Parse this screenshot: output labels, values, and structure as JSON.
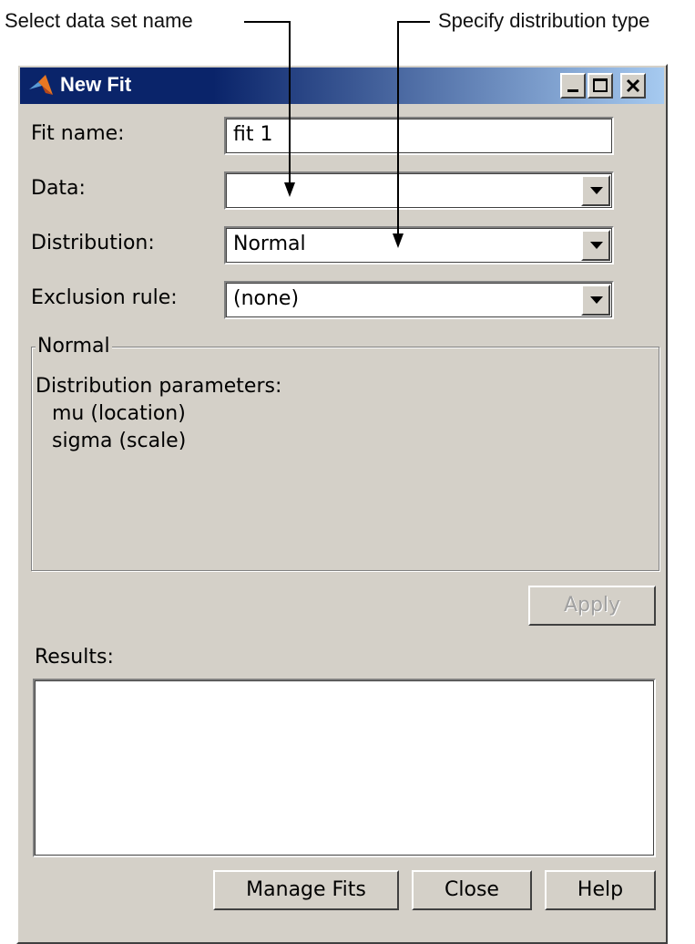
{
  "callouts": {
    "left": "Select data set name",
    "right": "Specify distribution type"
  },
  "window": {
    "title": "New Fit",
    "icon": "matlab-logo-icon",
    "controls": {
      "minimize": "minimize-icon",
      "maximize": "maximize-icon",
      "close": "close-icon"
    }
  },
  "form": {
    "fit_name_label": "Fit name:",
    "fit_name_value": "fit 1",
    "data_label": "Data:",
    "data_value": "",
    "distribution_label": "Distribution:",
    "distribution_value": "Normal",
    "exclusion_label": "Exclusion rule:",
    "exclusion_value": "(none)"
  },
  "group": {
    "title": "Normal",
    "params_label": "Distribution parameters:",
    "params": [
      "mu (location)",
      "sigma (scale)"
    ]
  },
  "buttons": {
    "apply": "Apply",
    "manage_fits": "Manage Fits",
    "close": "Close",
    "help": "Help"
  },
  "results": {
    "label": "Results:",
    "content": ""
  },
  "colors": {
    "dialog_bg": "#d4d0c8",
    "titlebar_start": "#0a246a",
    "titlebar_end": "#a6caf0"
  }
}
